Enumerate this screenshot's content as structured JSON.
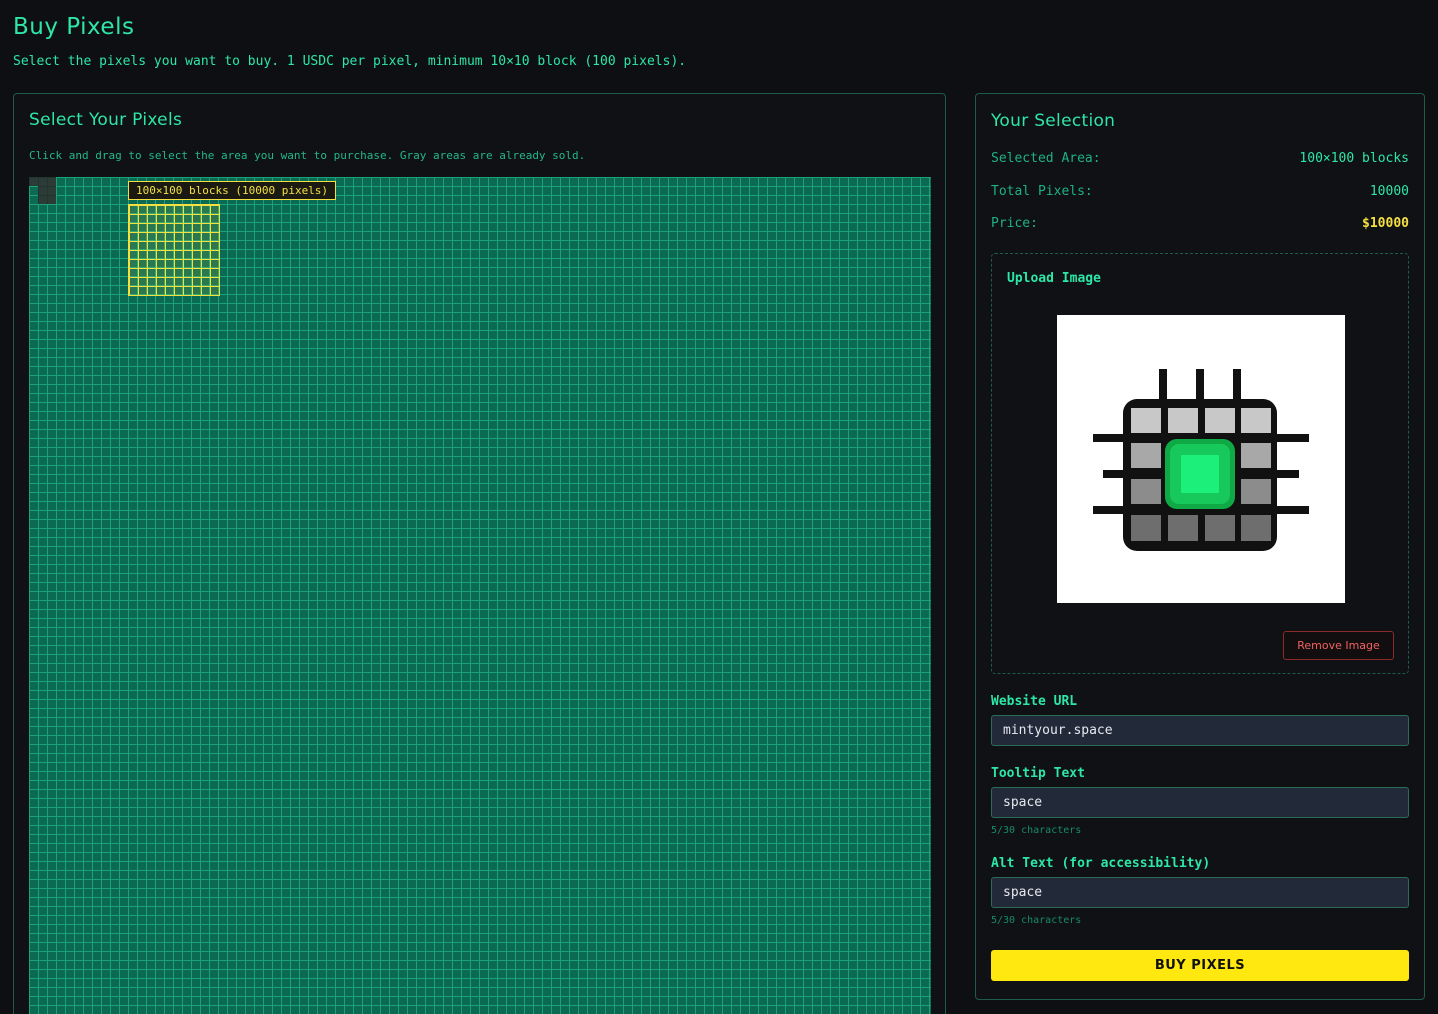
{
  "header": {
    "title": "Buy Pixels",
    "subtitle": "Select the pixels you want to buy. 1 USDC per pixel, minimum 10×10 block (100 pixels)."
  },
  "selector": {
    "title": "Select Your Pixels",
    "description": "Click and drag to select the area you want to purchase. Gray areas are already sold.",
    "selection_label": "100×100 blocks (10000 pixels)"
  },
  "selection": {
    "title": "Your Selection",
    "area_label": "Selected Area:",
    "area_value": "100×100 blocks",
    "pixels_label": "Total Pixels:",
    "pixels_value": "10000",
    "price_label": "Price:",
    "price_value": "$10000"
  },
  "upload": {
    "label": "Upload Image",
    "remove_label": "Remove Image"
  },
  "form": {
    "website_label": "Website URL",
    "website_value": "mintyour.space",
    "tooltip_label": "Tooltip Text",
    "tooltip_value": "space",
    "tooltip_count": "5/30 characters",
    "alt_label": "Alt Text (for accessibility)",
    "alt_value": "space",
    "alt_count": "5/30 characters"
  },
  "buy_label": "BUY PIXELS",
  "colors": {
    "accent": "#2ee6a6",
    "highlight": "#f5e042",
    "buy_button": "#ffe810",
    "danger": "#f06262"
  },
  "icons": [
    "chip-logo-image"
  ]
}
